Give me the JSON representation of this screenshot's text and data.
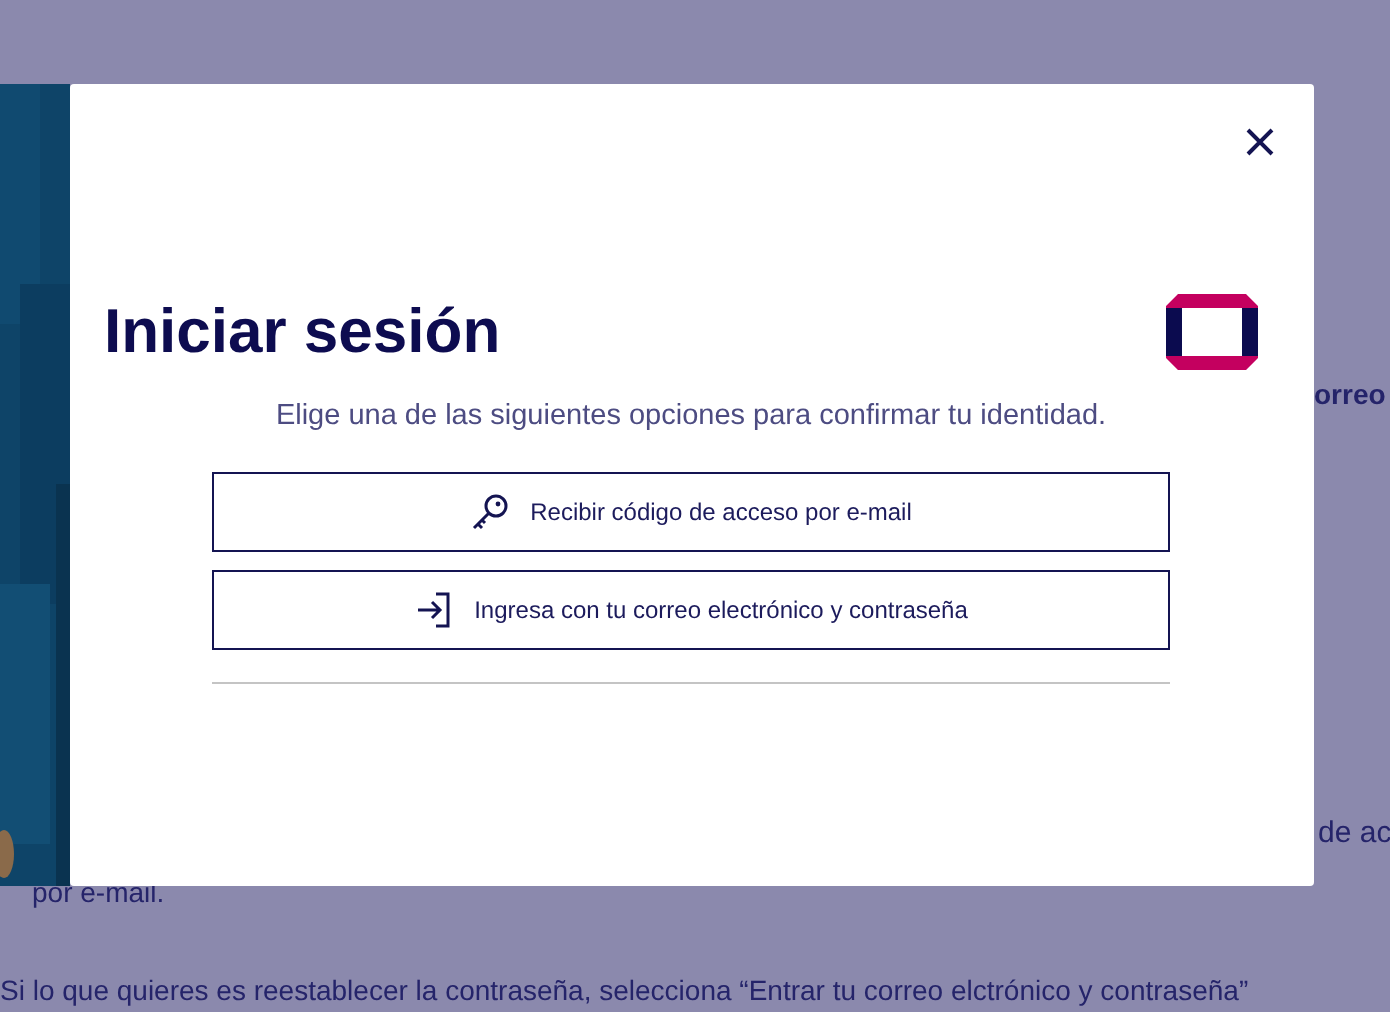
{
  "background_page": {
    "heading_fragment": "orreo",
    "paragraph_fragment": "de ac",
    "paragraph_continuation": "por e-mail.",
    "note": "Si lo que quieres es reestablecer la contraseña, selecciona “Entrar tu correo elctrónico y contraseña”"
  },
  "modal": {
    "title": "Iniciar sesión",
    "subtitle": "Elige una de las siguientes opciones para confirmar tu identidad.",
    "options": [
      {
        "kind": "key",
        "label": "Recibir código de acceso por e-mail"
      },
      {
        "kind": "login",
        "label": "Ingresa con tu correo electrónico y contraseña"
      }
    ]
  }
}
